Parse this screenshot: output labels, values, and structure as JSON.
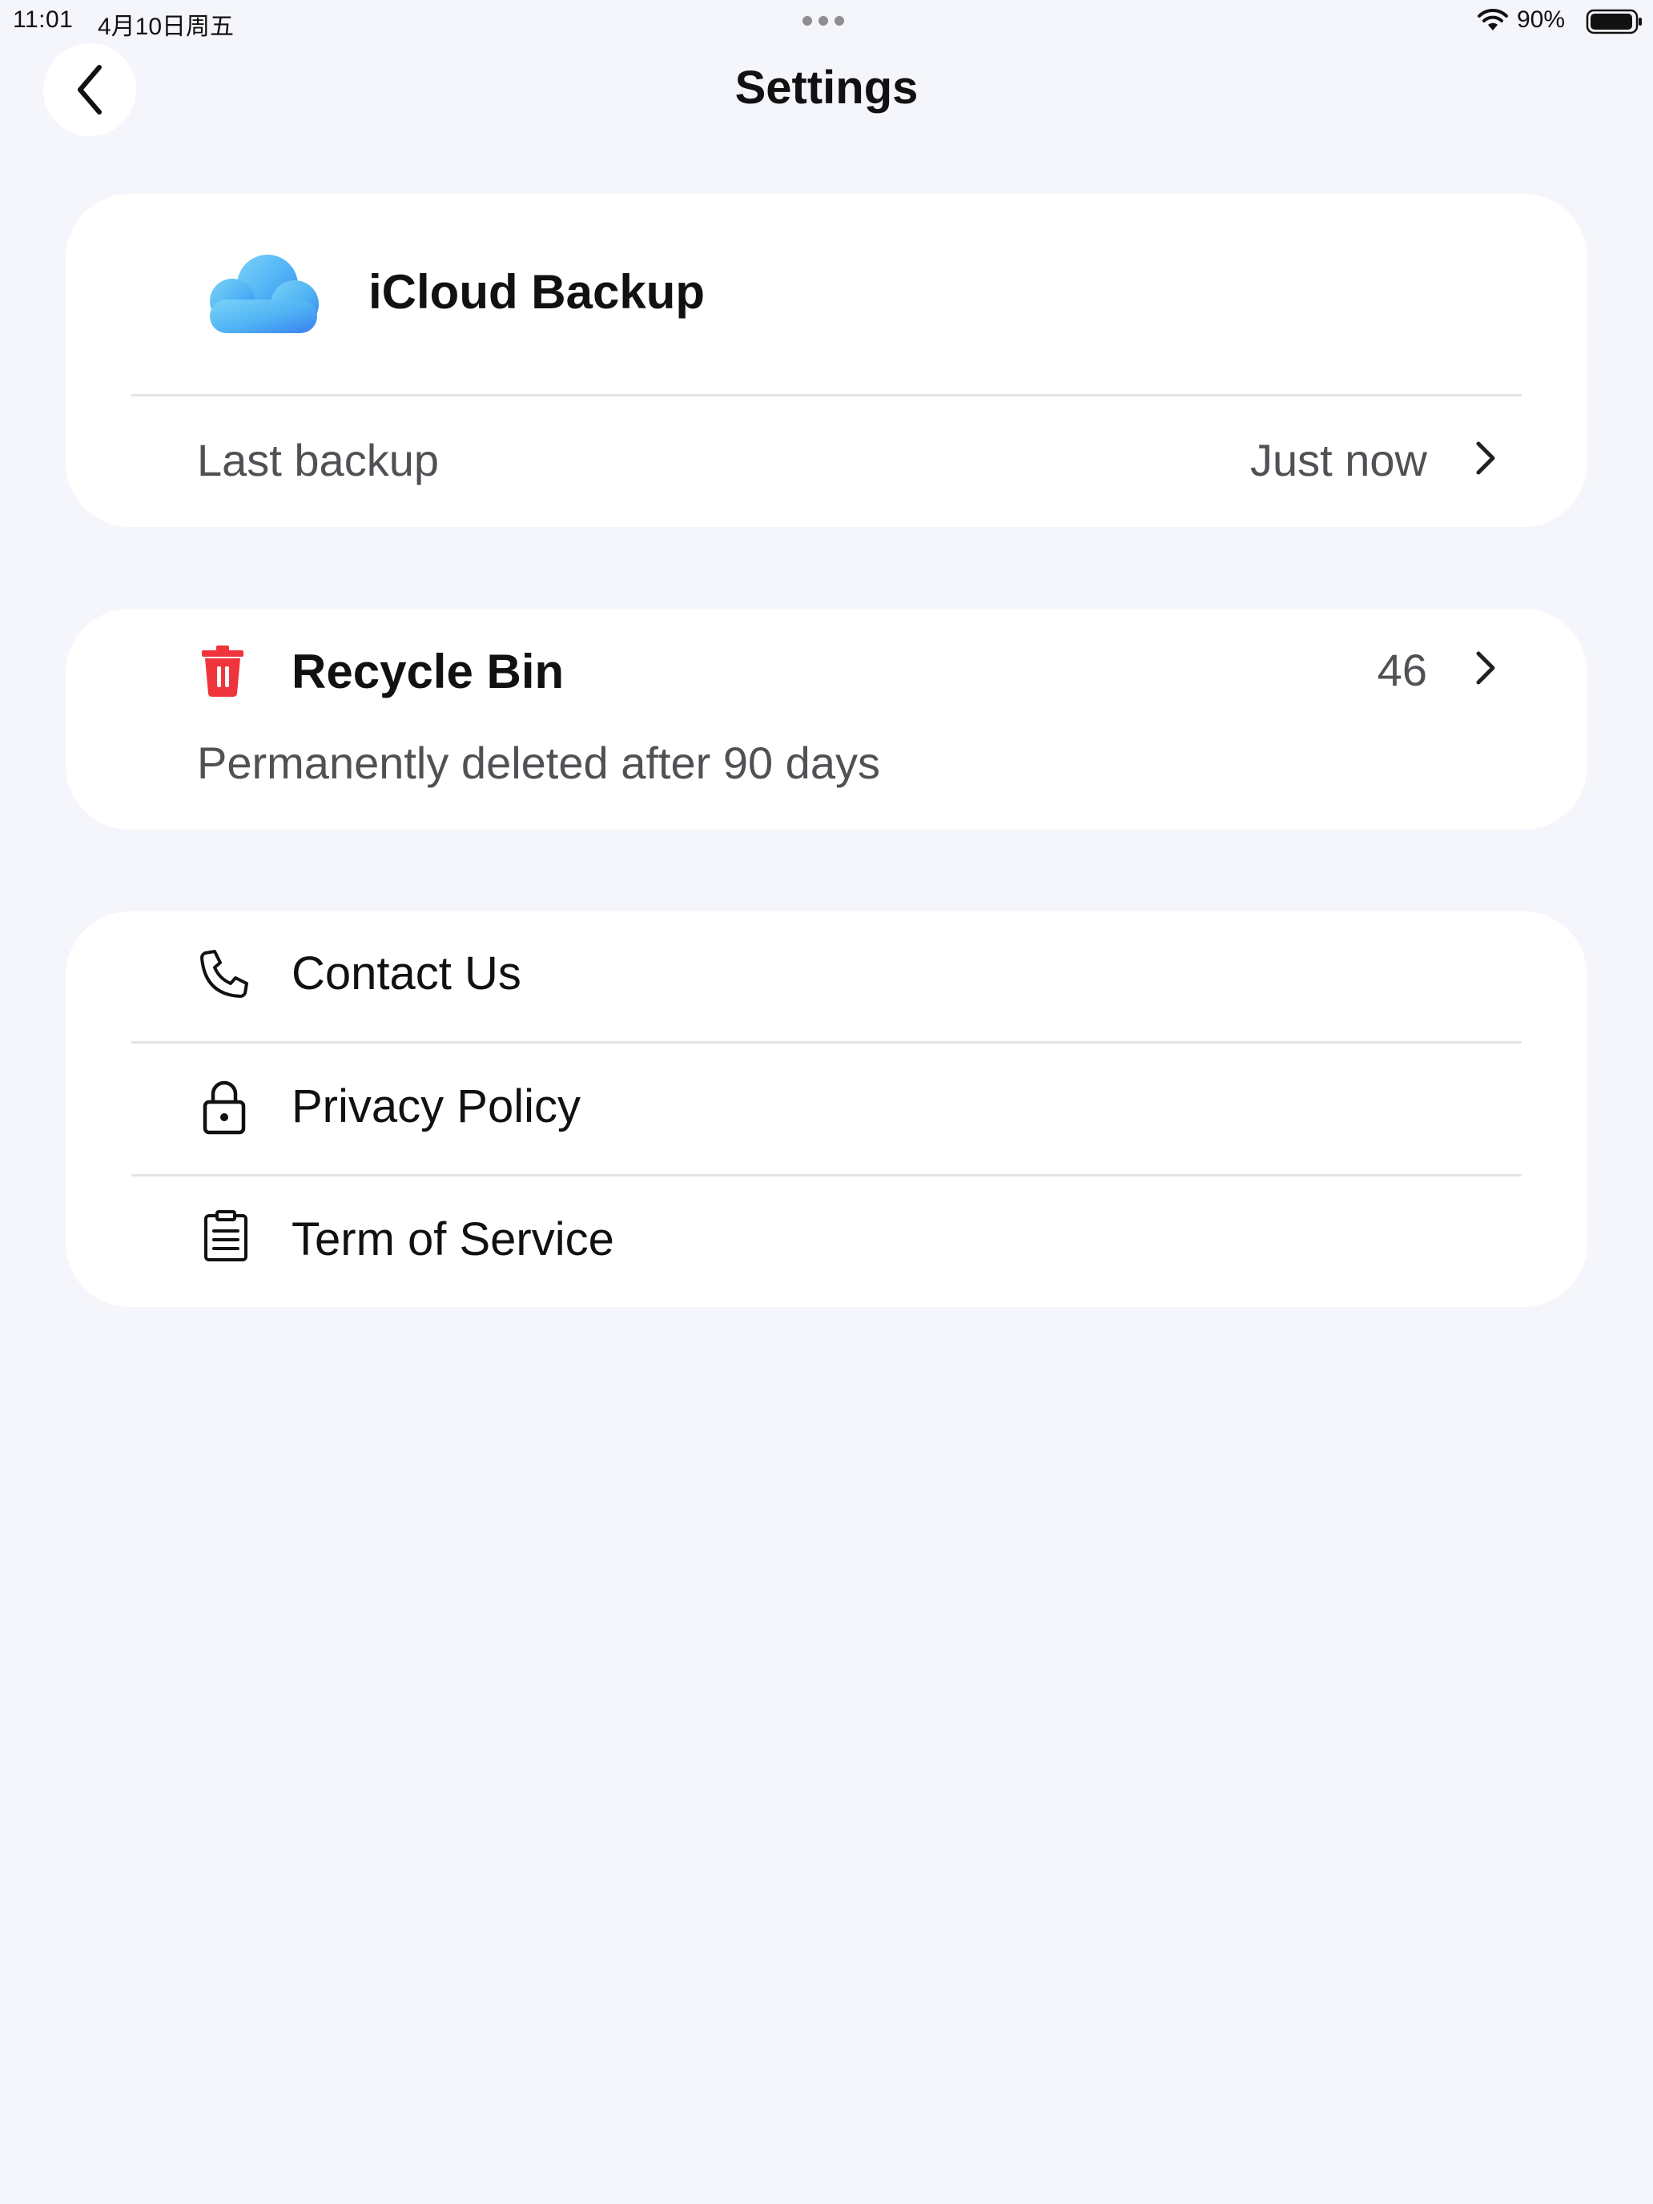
{
  "status_bar": {
    "time": "11:01",
    "date": "4月10日周五",
    "battery": "90%"
  },
  "header": {
    "title": "Settings",
    "back_icon": "chevron-left-icon"
  },
  "icloud": {
    "title": "iCloud Backup",
    "icon": "icloud-icon",
    "last_backup_label": "Last backup",
    "last_backup_value": "Just now"
  },
  "recycle_bin": {
    "title": "Recycle Bin",
    "icon": "trash-icon",
    "count": "46",
    "subtitle": "Permanently deleted after 90 days",
    "accent": "#f0343c"
  },
  "links": {
    "contact": {
      "label": "Contact Us",
      "icon": "phone-icon"
    },
    "privacy": {
      "label": "Privacy Policy",
      "icon": "lock-icon"
    },
    "terms": {
      "label": "Term of Service",
      "icon": "clipboard-icon"
    }
  },
  "colors": {
    "background": "#f5f6fb",
    "card": "#ffffff",
    "divider": "#e4e4e8",
    "secondary_text": "#505055",
    "cloud_top": "#62c6f5",
    "cloud_bottom": "#3d8ef0"
  }
}
